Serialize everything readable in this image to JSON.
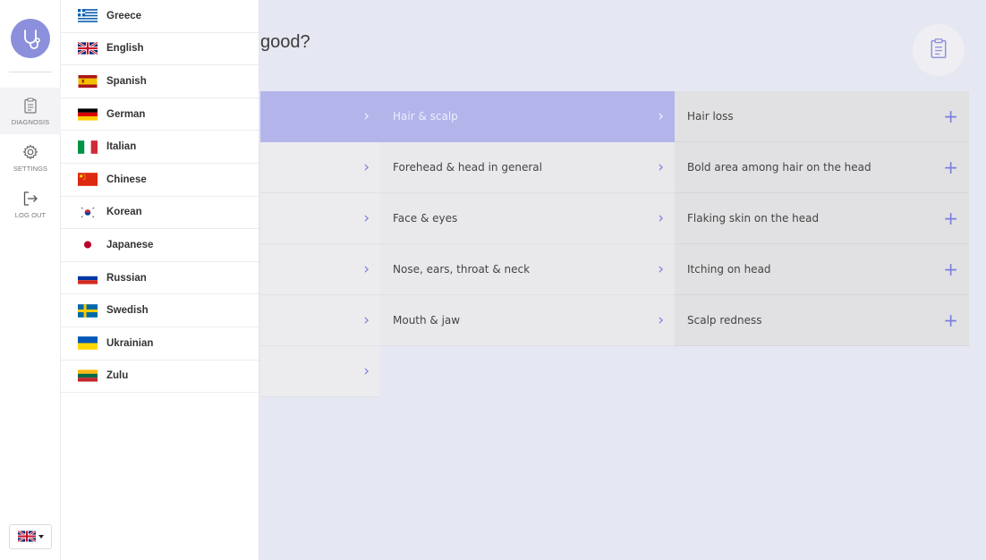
{
  "nav": {
    "items": [
      {
        "label": "DIAGNOSIS",
        "icon": "clipboard-icon",
        "active": true
      },
      {
        "label": "SETTINGS",
        "icon": "gear-icon",
        "active": false
      },
      {
        "label": "LOG OUT",
        "icon": "logout-icon",
        "active": false
      }
    ],
    "language_switch_icon": "uk-flag-icon"
  },
  "languages": [
    {
      "name": "Greece",
      "flag": "greece"
    },
    {
      "name": "English",
      "flag": "uk"
    },
    {
      "name": "Spanish",
      "flag": "spain"
    },
    {
      "name": "German",
      "flag": "germany"
    },
    {
      "name": "Italian",
      "flag": "italy"
    },
    {
      "name": "Chinese",
      "flag": "china"
    },
    {
      "name": "Korean",
      "flag": "korea"
    },
    {
      "name": "Japanese",
      "flag": "japan"
    },
    {
      "name": "Russian",
      "flag": "russia"
    },
    {
      "name": "Swedish",
      "flag": "sweden"
    },
    {
      "name": "Ukrainian",
      "flag": "ukraine"
    },
    {
      "name": "Zulu",
      "flag": "lithuania-like"
    }
  ],
  "main": {
    "question": "good?",
    "body_areas": [
      "",
      "",
      "",
      "",
      "",
      ""
    ],
    "subareas": [
      {
        "label": "Hair & scalp",
        "selected": true
      },
      {
        "label": "Forehead & head in general"
      },
      {
        "label": "Face & eyes"
      },
      {
        "label": "Nose, ears, throat & neck"
      },
      {
        "label": "Mouth & jaw"
      }
    ],
    "symptoms": [
      "Hair loss",
      "Bold area among hair on the head",
      "Flaking skin on the head",
      "Itching on head",
      "Scalp redness"
    ]
  },
  "colors": {
    "accent": "#8c8fdc",
    "selected_row": "#b3b5ea",
    "background": "#e5e7f2"
  }
}
